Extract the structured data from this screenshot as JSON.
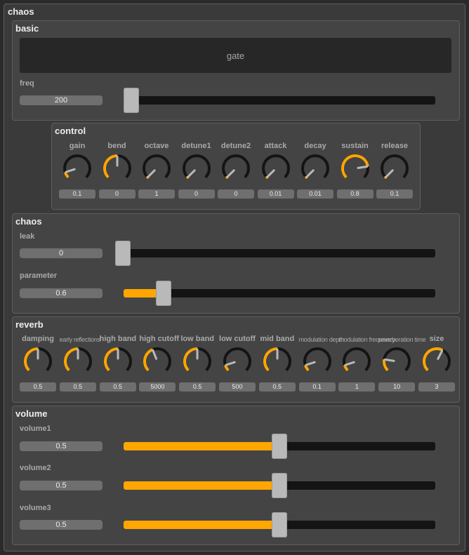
{
  "app": {
    "title": "chaos"
  },
  "colors": {
    "accent": "#ffa600",
    "panel": "#444444",
    "track": "#141414"
  },
  "basic": {
    "title": "basic",
    "gate_label": "gate",
    "freq": {
      "label": "freq",
      "value": "200",
      "fraction": 0.0
    }
  },
  "control": {
    "title": "control",
    "knobs": [
      {
        "label": "gain",
        "value": "0.1",
        "fraction": 0.1
      },
      {
        "label": "bend",
        "value": "0",
        "fraction": 0.5
      },
      {
        "label": "octave",
        "value": "1",
        "fraction": 0.0
      },
      {
        "label": "detune1",
        "value": "0",
        "fraction": 0.0
      },
      {
        "label": "detune2",
        "value": "0",
        "fraction": 0.0
      },
      {
        "label": "attack",
        "value": "0.01",
        "fraction": 0.0
      },
      {
        "label": "decay",
        "value": "0.01",
        "fraction": 0.0
      },
      {
        "label": "sustain",
        "value": "0.8",
        "fraction": 0.8
      },
      {
        "label": "release",
        "value": "0.1",
        "fraction": 0.0
      }
    ]
  },
  "chaos": {
    "title": "chaos",
    "leak": {
      "label": "leak",
      "value": "0",
      "fraction": 0.0
    },
    "parameter": {
      "label": "parameter",
      "value": "0.6",
      "fraction": 0.11
    }
  },
  "reverb": {
    "title": "reverb",
    "knobs": [
      {
        "label": "damping",
        "value": "0.5",
        "fraction": 0.5
      },
      {
        "label": "early reflections",
        "value": "0.5",
        "fraction": 0.5
      },
      {
        "label": "high band",
        "value": "0.5",
        "fraction": 0.5
      },
      {
        "label": "high cutoff",
        "value": "5000",
        "fraction": 0.42
      },
      {
        "label": "low band",
        "value": "0.5",
        "fraction": 0.5
      },
      {
        "label": "low cutoff",
        "value": "500",
        "fraction": 0.1
      },
      {
        "label": "mid band",
        "value": "0.5",
        "fraction": 0.5
      },
      {
        "label": "modulation depth",
        "value": "0.1",
        "fraction": 0.1
      },
      {
        "label": "modulation frequency",
        "value": "1",
        "fraction": 0.1
      },
      {
        "label": "reverberation time",
        "value": "10",
        "fraction": 0.2
      },
      {
        "label": "size",
        "value": "3",
        "fraction": 0.6
      }
    ]
  },
  "volume": {
    "title": "volume",
    "sliders": [
      {
        "label": "volume1",
        "value": "0.5",
        "fraction": 0.5
      },
      {
        "label": "volume2",
        "value": "0.5",
        "fraction": 0.5
      },
      {
        "label": "volume3",
        "value": "0.5",
        "fraction": 0.5
      }
    ]
  }
}
